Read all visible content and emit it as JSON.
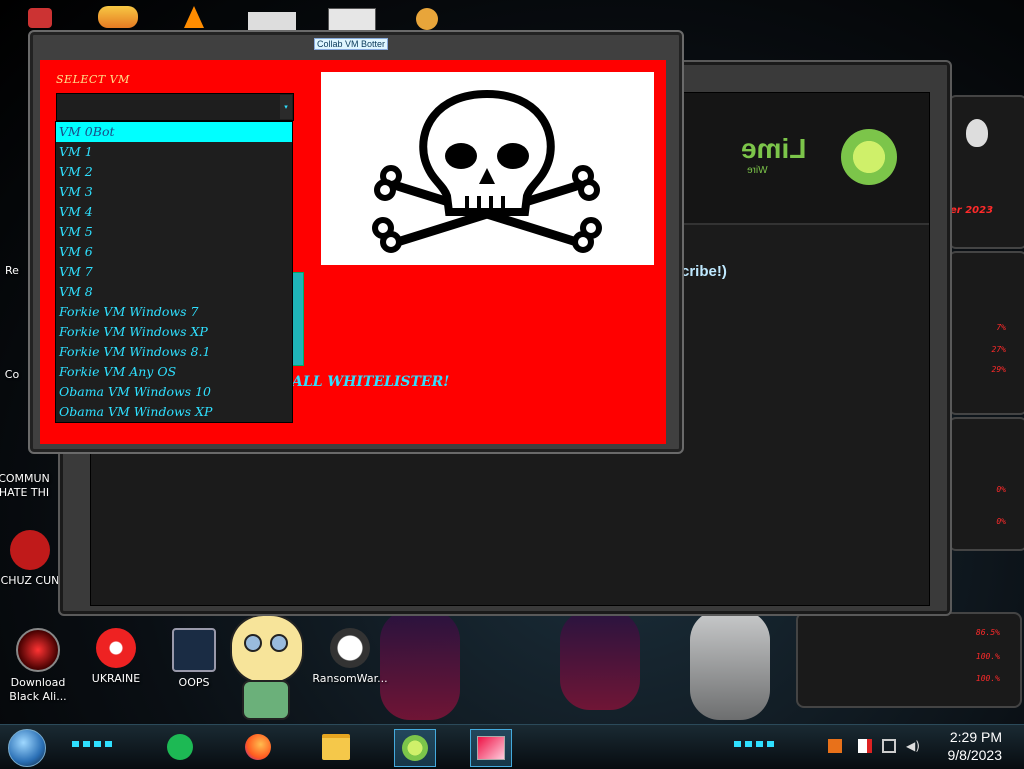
{
  "main_window": {
    "title": "Collab VM Botter",
    "select_label": "SELECT VM",
    "whitelister_text": "ALL WHITELISTER!",
    "dropdown_arrow": "▾",
    "vm_options": [
      "VM 0Bot",
      "VM 1",
      "VM 2",
      "VM 3",
      "VM 4",
      "VM 5",
      "VM 6",
      "VM 7",
      "VM 8",
      "Forkie VM Windows 7",
      "Forkie VM Windows XP",
      "Forkie VM Windows 8.1",
      "Forkie VM Any OS",
      "Obama VM Windows 10",
      "Obama VM Windows XP"
    ],
    "highlighted_option": "VM 0Bot",
    "image": "skull-and-crossbones-icon"
  },
  "back_window": {
    "logo": "Lime",
    "logo_sub": "Wire",
    "partial_text": "cribe!)"
  },
  "gadget": {
    "label": "er 2023",
    "percents": [
      "7%",
      "27%",
      "29%",
      "0%",
      "0%",
      "86.5%",
      "100.%",
      "100.%"
    ]
  },
  "desktop_icons": [
    {
      "label": "Download Black Ali...",
      "icon": "alienware-icon"
    },
    {
      "label": "UKRAINE",
      "icon": "radiation-icon"
    },
    {
      "label": "OOPS",
      "icon": "monitor-icon"
    },
    {
      "label": "RansomWar...",
      "icon": "skull-icon"
    },
    {
      "label": "COMMUN HATE THI",
      "icon": "app-icon"
    },
    {
      "label": "CHUZ CUN",
      "icon": "app-icon"
    },
    {
      "label": "Re",
      "icon": "app-icon"
    },
    {
      "label": "Co",
      "icon": "app-icon"
    }
  ],
  "taskbar": {
    "time": "2:29 PM",
    "date": "9/8/2023",
    "apps": [
      "spotify-icon",
      "firefox-icon",
      "file-explorer-icon",
      "limewire-icon",
      "collab-vm-botter-icon"
    ]
  },
  "colors": {
    "accent_cyan": "#2fe0ff",
    "red_panel": "#ff0000",
    "highlight": "#00ffff"
  }
}
